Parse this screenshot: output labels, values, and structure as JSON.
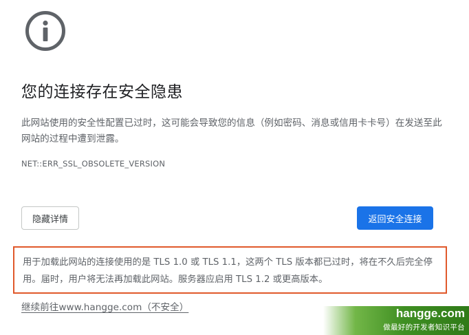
{
  "icons": {
    "info_icon": "info-circle-icon",
    "icon_color": "#5f6368"
  },
  "interstitial": {
    "title": "您的连接存在安全隐患",
    "description": "此网站使用的安全性配置已过时，这可能会导致您的信息（例如密码、消息或信用卡卡号）在发送至此网站的过程中遭到泄露。",
    "error_code": "NET::ERR_SSL_OBSOLETE_VERSION",
    "details_button_label": "隐藏详情",
    "primary_button_label": "返回安全连接",
    "details_text": "用于加载此网站的连接使用的是 TLS 1.0 或 TLS 1.1，这两个 TLS 版本都已过时，将在不久后完全停用。届时，用户将无法再加载此网站。服务器应启用 TLS 1.2 或更高版本。",
    "proceed_link": "继续前往www.hangge.com（不安全）"
  },
  "colors": {
    "primary_button": "#1a73e8",
    "highlight_border": "#e0582a",
    "body_text": "#5f6368"
  },
  "watermark": {
    "site": "hangge.com",
    "tagline": "做最好的开发者知识平台"
  }
}
